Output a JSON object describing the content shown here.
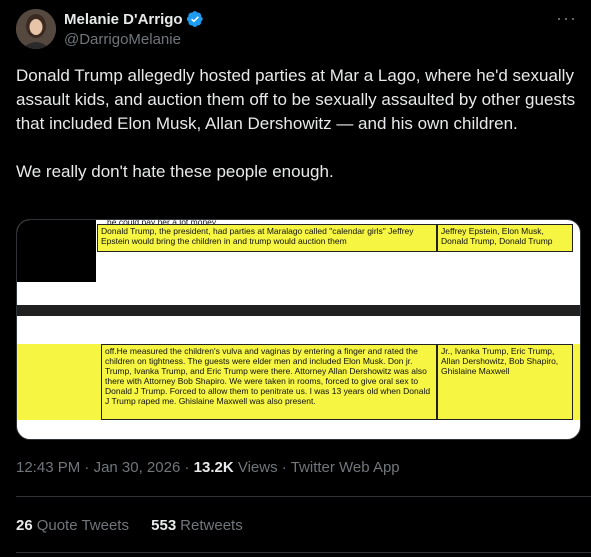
{
  "author": {
    "display_name": "Melanie D'Arrigo",
    "handle": "@DarrigoMelanie",
    "verified": true
  },
  "tweet": {
    "paragraph1": "Donald Trump allegedly hosted parties at Mar a Lago, where he'd sexually assault kids, and auction them off to be sexually assaulted by other guests that included Elon Musk, Allan Dershowitz — and his own children.",
    "paragraph2": "We really don't hate these people enough."
  },
  "media": {
    "top_cut_line": "he could pay her a lot money.",
    "top_left_cell": "Donald Trump, the president, had parties at Maralago called \"calendar girls\" Jeffrey Epstein would bring the children in and trump would auction them",
    "top_right_cell": "Jeffrey Epstein, Elon Musk, Donald Trump, Donald Trump",
    "bottom_left_cell": "off.He measured the children's vulva and vaginas by entering a finger and rated the children on tightness. The guests were elder men and included Elon Musk. Don jr. Trump, Ivanka Trump, and Eric Trump were there. Attorney Allan Dershowitz was also there with Attorney Bob Shapiro. We were taken in rooms, forced to give oral sex to Donald J Trump. Forced to allow them to penitrate us. I was 13 years old when Donald J Trump raped me. Ghislaine Maxwell was also present.",
    "bottom_right_cell": "Jr., Ivanka Trump, Eric Trump, Allan Dershowitz, Bob Shapiro, Ghislaine Maxwell"
  },
  "meta": {
    "time": "12:43 PM",
    "dot": "·",
    "date": "Jan 30, 2026",
    "views_count": "13.2K",
    "views_label": "Views",
    "source": "Twitter Web App"
  },
  "stats": {
    "quote_count": "26",
    "quote_label": "Quote Tweets",
    "retweet_count": "553",
    "retweet_label": "Retweets"
  },
  "colors": {
    "background": "#000000",
    "text": "#e7e9ea",
    "muted": "#71767b",
    "verified": "#1d9bf0",
    "highlight": "#f5f542"
  },
  "icons": [
    "verified-badge-icon",
    "more-icon"
  ]
}
